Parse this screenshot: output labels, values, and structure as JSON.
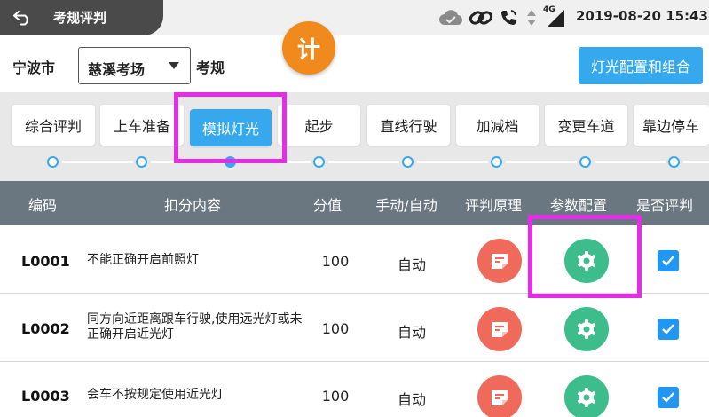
{
  "window": {
    "title": "考规评判",
    "time": "2019-08-20 15:43",
    "network_label": "4G",
    "back_icon": "back-arrow-icon"
  },
  "filters": {
    "city": "宁波市",
    "site": "慈溪考场",
    "exam_label": "考规",
    "timer_label": "计",
    "config_button": "灯光配置和组合"
  },
  "tabs": [
    {
      "label": "综合评判",
      "active": false
    },
    {
      "label": "上车准备",
      "active": false
    },
    {
      "label": "模拟灯光",
      "active": true
    },
    {
      "label": "起步",
      "active": false
    },
    {
      "label": "直线行驶",
      "active": false
    },
    {
      "label": "加减档",
      "active": false
    },
    {
      "label": "变更车道",
      "active": false
    },
    {
      "label": "靠边停车",
      "active": false
    }
  ],
  "table": {
    "headers": {
      "code": "编码",
      "content": "扣分内容",
      "score": "分值",
      "mode": "手动/自动",
      "rule": "评判原理",
      "param": "参数配置",
      "judge": "是否评判"
    },
    "rows": [
      {
        "code": "L0001",
        "content": "不能正确开启前照灯",
        "score": "100",
        "mode": "自动",
        "judged": true
      },
      {
        "code": "L0002",
        "content": "同方向近距离跟车行驶,使用远光灯或未正确开启近光灯",
        "score": "100",
        "mode": "自动",
        "judged": true
      },
      {
        "code": "L0003",
        "content": "会车不按规定使用近光灯",
        "score": "100",
        "mode": "自动",
        "judged": true
      }
    ]
  },
  "colors": {
    "accent": "#36a8ee",
    "rule_button": "#ef6a5b",
    "param_button": "#3dbd8b",
    "header_bg": "#6b7780",
    "timer_badge": "#f08a1c",
    "highlight": "#e62ce8"
  }
}
